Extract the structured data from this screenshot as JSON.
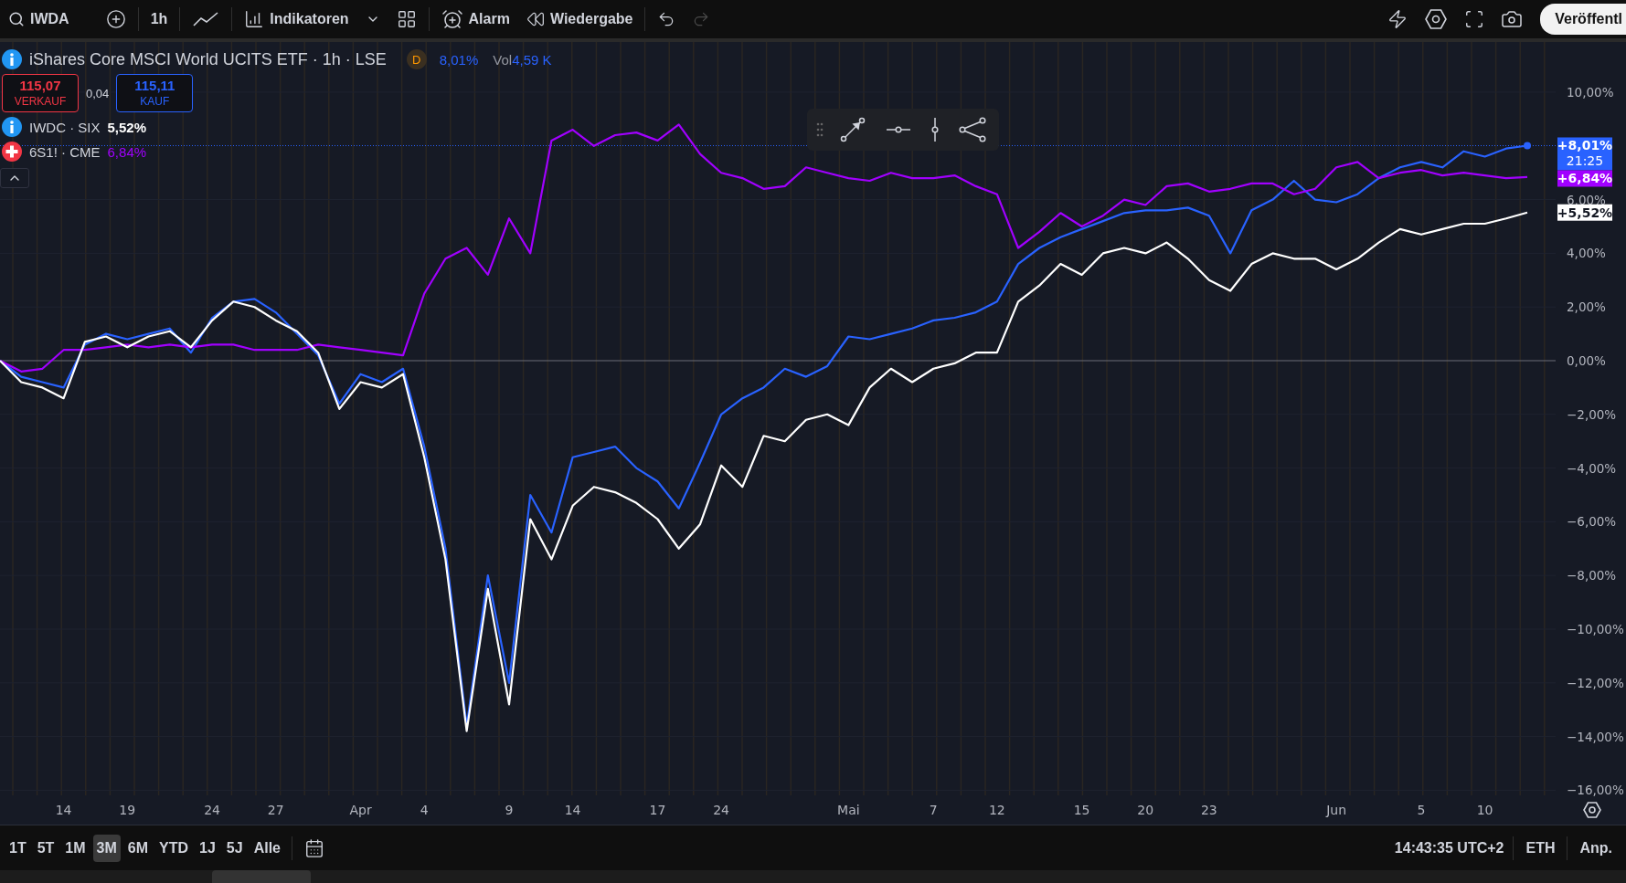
{
  "toolbar": {
    "symbol": "IWDA",
    "interval": "1h",
    "indicators": "Indikatoren",
    "alarm": "Alarm",
    "replay": "Wiedergabe",
    "redo": {
      "disabled": true
    },
    "publish": "Veröffentl"
  },
  "legend": {
    "title": "iShares Core MSCI World UCITS ETF · 1h · LSE",
    "badge": "D",
    "change": "8,01%",
    "vol_label": "Vol",
    "vol_value": "4,59 K",
    "sell": {
      "price": "115,07",
      "label": "VERKAUF"
    },
    "spread": "0,04",
    "buy": {
      "price": "115,11",
      "label": "KAUF"
    },
    "compare": [
      {
        "kind": "info",
        "label": "IWDC · SIX",
        "change": "5,52%",
        "color": "#ffffff"
      },
      {
        "kind": "flag",
        "label": "6S1! · CME",
        "change": "6,84%",
        "color": "#a100ff"
      }
    ]
  },
  "chart": {
    "chart_data": {
      "type": "line",
      "categories": [
        null,
        null,
        null,
        "14",
        null,
        null,
        "19",
        null,
        null,
        null,
        "24",
        null,
        null,
        "27",
        null,
        null,
        null,
        "Apr",
        null,
        null,
        "4",
        null,
        null,
        null,
        "9",
        null,
        null,
        "14",
        null,
        null,
        null,
        "17",
        null,
        null,
        "24",
        null,
        null,
        null,
        null,
        null,
        "Mai",
        null,
        null,
        null,
        "7",
        null,
        null,
        "12",
        null,
        null,
        null,
        "15",
        null,
        null,
        "20",
        null,
        null,
        "23",
        null,
        null,
        null,
        null,
        null,
        "Jun",
        null,
        null,
        null,
        "5",
        null,
        null,
        "10",
        null,
        null
      ],
      "series": [
        {
          "color": "#2962ff",
          "values": [
            0,
            -0.6,
            -0.8,
            -1.0,
            0.6,
            1.0,
            0.8,
            1.0,
            1.2,
            0.3,
            1.6,
            2.2,
            2.3,
            1.8,
            1.0,
            0.2,
            -1.6,
            -0.5,
            -0.8,
            -0.3,
            -3.2,
            -7.0,
            -13.6,
            -8.0,
            -12.0,
            -5.0,
            -6.4,
            -3.6,
            -3.4,
            -3.2,
            -4.0,
            -4.5,
            -5.5,
            -3.8,
            -2.0,
            -1.4,
            -1.0,
            -0.3,
            -0.6,
            -0.2,
            0.9,
            0.8,
            1.0,
            1.2,
            1.5,
            1.6,
            1.8,
            2.2,
            3.6,
            4.2,
            4.6,
            4.9,
            5.2,
            5.5,
            5.6,
            5.6,
            5.7,
            5.4,
            4.0,
            5.6,
            6.0,
            6.7,
            6.0,
            5.9,
            6.2,
            6.8,
            7.2,
            7.4,
            7.2,
            7.8,
            7.6,
            7.9,
            8.01
          ]
        },
        {
          "color": "#a100ff",
          "values": [
            0,
            -0.4,
            -0.3,
            0.4,
            0.4,
            0.5,
            0.6,
            0.5,
            0.6,
            0.5,
            0.6,
            0.6,
            0.4,
            0.4,
            0.4,
            0.6,
            0.5,
            0.4,
            0.3,
            0.2,
            2.5,
            3.8,
            4.2,
            3.2,
            5.3,
            4.0,
            8.2,
            8.6,
            8.0,
            8.4,
            8.5,
            8.2,
            8.8,
            7.7,
            7.0,
            6.8,
            6.4,
            6.5,
            7.2,
            7.0,
            6.8,
            6.7,
            7.0,
            6.8,
            6.8,
            6.9,
            6.5,
            6.2,
            4.2,
            4.8,
            5.5,
            5.0,
            5.4,
            6.0,
            5.8,
            6.5,
            6.6,
            6.3,
            6.4,
            6.6,
            6.6,
            6.2,
            6.4,
            7.2,
            7.4,
            6.8,
            7.0,
            7.1,
            6.9,
            7.0,
            6.9,
            6.8,
            6.84
          ]
        },
        {
          "color": "#ffffff",
          "values": [
            0,
            -0.8,
            -1,
            -1.4,
            0.7,
            0.9,
            0.5,
            0.9,
            1.1,
            0.5,
            1.5,
            2.2,
            2.0,
            1.5,
            1.1,
            0.3,
            -1.8,
            -0.8,
            -1.0,
            -0.5,
            -3.6,
            -7.4,
            -13.8,
            -8.5,
            -12.8,
            -5.9,
            -7.4,
            -5.4,
            -4.7,
            -4.9,
            -5.3,
            -5.9,
            -7.0,
            -6.1,
            -3.9,
            -4.7,
            -2.8,
            -3.0,
            -2.2,
            -2.0,
            -2.4,
            -1.0,
            -0.3,
            -0.8,
            -0.3,
            -0.1,
            0.3,
            0.3,
            2.2,
            2.8,
            3.6,
            3.2,
            4.0,
            4.2,
            4.0,
            4.4,
            3.8,
            3.0,
            2.6,
            3.6,
            4.0,
            3.8,
            3.8,
            3.4,
            3.8,
            4.4,
            4.9,
            4.7,
            4.9,
            5.1,
            5.1,
            5.3,
            5.52
          ]
        }
      ],
      "ylim": [
        -16.19,
        11.87
      ],
      "grid": true,
      "ref_lines": [
        {
          "axis": "y",
          "value": 8.01,
          "color": "#2962ff"
        }
      ],
      "yticks": [
        {
          "value": 10,
          "label": "10,00%"
        },
        {
          "value": 6,
          "label": "6,00%"
        },
        {
          "value": 4,
          "label": "4,00%"
        },
        {
          "value": 2,
          "label": "2,00%"
        },
        {
          "value": 0,
          "label": "0,00%"
        },
        {
          "value": -2,
          "label": "−2,00%"
        },
        {
          "value": -4,
          "label": "−4,00%"
        },
        {
          "value": -6,
          "label": "−6,00%"
        },
        {
          "value": -8,
          "label": "−8,00%"
        },
        {
          "value": -10,
          "label": "−10,00%"
        },
        {
          "value": -12,
          "label": "−12,00%"
        },
        {
          "value": -14,
          "label": "−14,00%"
        },
        {
          "value": -16,
          "label": "−16,00%"
        }
      ]
    },
    "price_labels": [
      {
        "text": "+8,01%",
        "time": "21:25",
        "color": "#2962ff"
      },
      {
        "text": "+6,84%",
        "color": "#a100ff"
      },
      {
        "text": "+5,52%",
        "color": "#ffffff"
      }
    ]
  },
  "ranges": [
    {
      "label": "1T",
      "selected": false
    },
    {
      "label": "5T",
      "selected": false
    },
    {
      "label": "1M",
      "selected": false
    },
    {
      "label": "3M",
      "selected": true
    },
    {
      "label": "6M",
      "selected": false
    },
    {
      "label": "YTD",
      "selected": false
    },
    {
      "label": "1J",
      "selected": false
    },
    {
      "label": "5J",
      "selected": false
    },
    {
      "label": "Alle",
      "selected": false
    }
  ],
  "status": {
    "time": "14:43:35 UTC+2",
    "session": "ETH",
    "adjust": "Anp."
  }
}
